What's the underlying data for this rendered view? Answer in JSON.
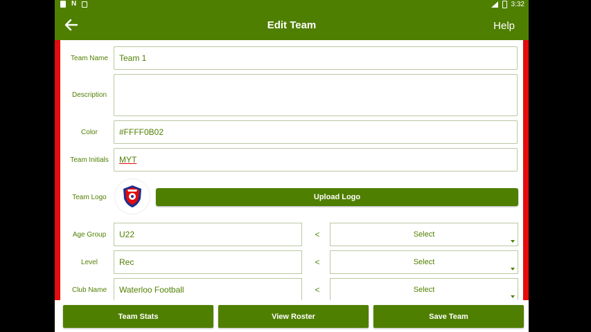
{
  "statusbar": {
    "time": "3:32",
    "notif_n": "N"
  },
  "appbar": {
    "title": "Edit Team",
    "help_label": "Help"
  },
  "colors": {
    "primary": "#4f7f00",
    "accent_red": "#e30b0b"
  },
  "form": {
    "team_name": {
      "label": "Team Name",
      "value": "Team 1"
    },
    "description": {
      "label": "Description",
      "value": ""
    },
    "color": {
      "label": "Color",
      "value": "#FFFF0B02"
    },
    "team_initials": {
      "label": "Team Initials",
      "value": "MYT"
    },
    "team_logo": {
      "label": "Team Logo",
      "upload_label": "Upload Logo"
    },
    "age_group": {
      "label": "Age Group",
      "value": "U22",
      "separator": "<",
      "select": "Select"
    },
    "level": {
      "label": "Level",
      "value": "Rec",
      "separator": "<",
      "select": "Select"
    },
    "club_name": {
      "label": "Club Name",
      "value": "Waterloo Football",
      "separator": "<",
      "select": "Select"
    }
  },
  "bottom_buttons": {
    "team_stats": "Team Stats",
    "view_roster": "View Roster",
    "save_team": "Save Team"
  }
}
